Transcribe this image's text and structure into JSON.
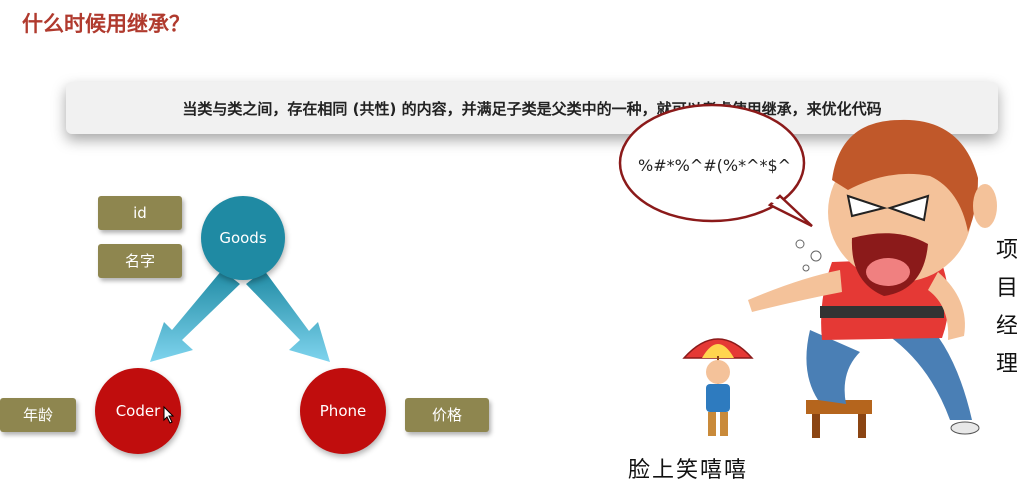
{
  "page": {
    "title": "什么时候用继承？"
  },
  "banner": {
    "text": "当类与类之间，存在相同 (共性) 的内容，并满足子类是父类中的一种，就可以考虑使用继承，来优化代码"
  },
  "diagram": {
    "parent": "Goods",
    "children": [
      "Coder",
      "Phone"
    ],
    "parent_attrs": [
      "id",
      "名字"
    ],
    "coder_attr": "年龄",
    "phone_attr": "价格"
  },
  "cartoon": {
    "speech": "%#*%^#(%*^*$^",
    "caption": "脸上笑嘻嘻",
    "side_text": [
      "项",
      "目",
      "经",
      "理"
    ]
  },
  "colors": {
    "title": "#b03a2e",
    "goods": "#1f8aa3",
    "child": "#c00d0d",
    "tag": "#8e864f",
    "arrow": "#5cc3e6"
  }
}
